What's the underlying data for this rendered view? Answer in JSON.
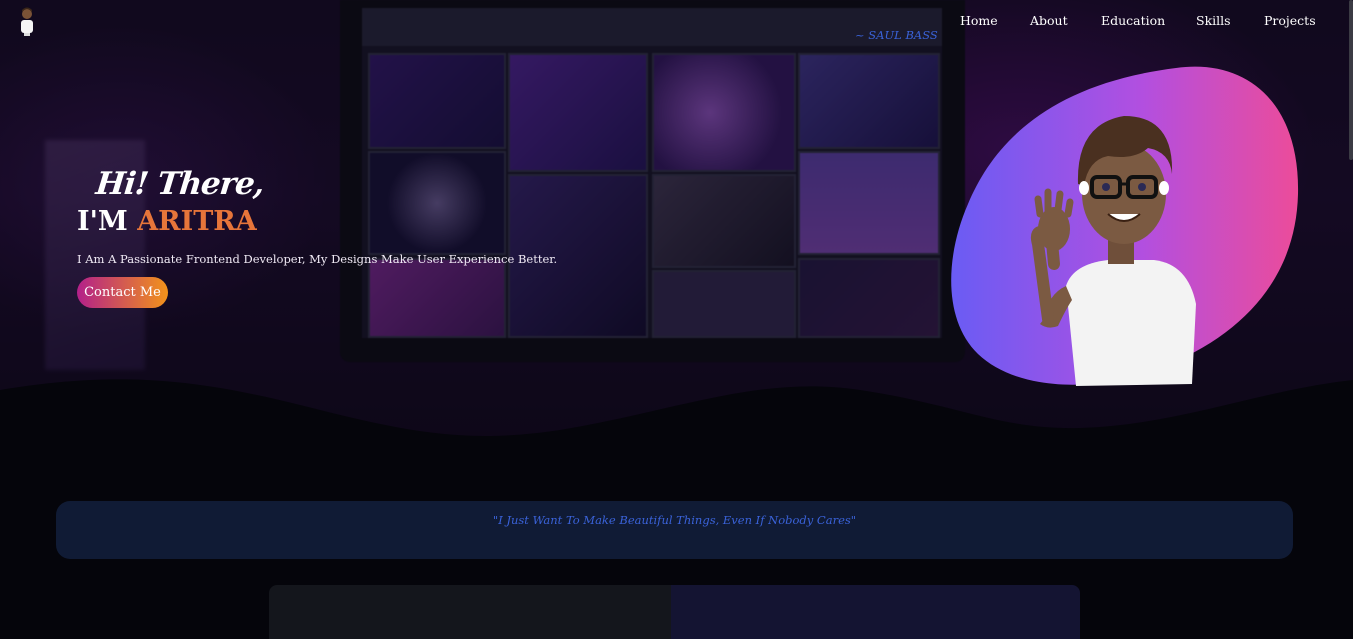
{
  "nav": {
    "logo_icon": "avatar-logo-icon",
    "items": [
      {
        "label": "Home"
      },
      {
        "label": "About"
      },
      {
        "label": "Education"
      },
      {
        "label": "Skills"
      },
      {
        "label": "Projects"
      }
    ]
  },
  "hero": {
    "greeting": "Hi! There,",
    "name_prefix": "I'M ",
    "name_highlight": "ARITRA",
    "tagline": "I Am A Passionate Frontend Developer, My Designs Make User Experience Better.",
    "contact_label": "Contact Me",
    "avatar_icon": "waving-memoji-avatar"
  },
  "quote": {
    "text": "\"I Just Want To Make Beautiful Things, Even If Nobody Cares\"",
    "author": "~ SAUL BASS"
  },
  "colors": {
    "accent_orange": "#e6753a",
    "button_gradient_start": "#b3208a",
    "button_gradient_end": "#f2931a",
    "blob_gradient_start": "#6a5cf4",
    "blob_gradient_end": "#ec4c9a",
    "quote_text": "#3a62d8",
    "quote_bg": "#101b35"
  }
}
